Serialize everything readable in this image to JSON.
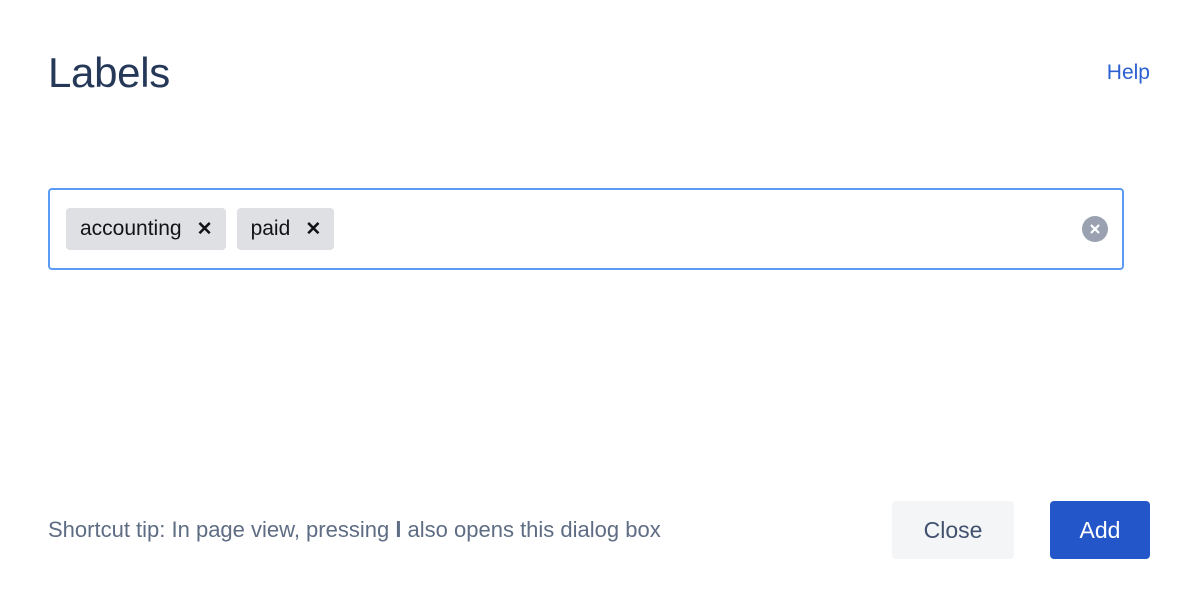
{
  "dialog": {
    "title": "Labels",
    "help_link_label": "Help"
  },
  "field": {
    "name": "labels-input",
    "placeholder": "",
    "input_value": "",
    "chips": [
      {
        "label": "accounting",
        "remove_glyph": "✕"
      },
      {
        "label": "paid",
        "remove_glyph": "✕"
      }
    ],
    "clear_all_icon": "clear-circle-icon"
  },
  "footer": {
    "shortcut_tip_prefix": "Shortcut tip: In page view, pressing ",
    "shortcut_key": "l",
    "shortcut_tip_suffix": " also opens this dialog box",
    "close_label": "Close",
    "add_label": "Add"
  },
  "colors": {
    "title": "#253858",
    "link": "#2C5FD0",
    "field_border_focus": "#5B9AF5",
    "chip_background": "#DEE0E4",
    "chip_text": "#111315",
    "clear_circle": "#9AA2B1",
    "footer_text": "#5E6C84",
    "close_background": "#F4F5F7",
    "close_text": "#42526E",
    "add_background": "#2356C8",
    "add_text": "#FFFFFF",
    "page_background": "#FFFFFF"
  }
}
